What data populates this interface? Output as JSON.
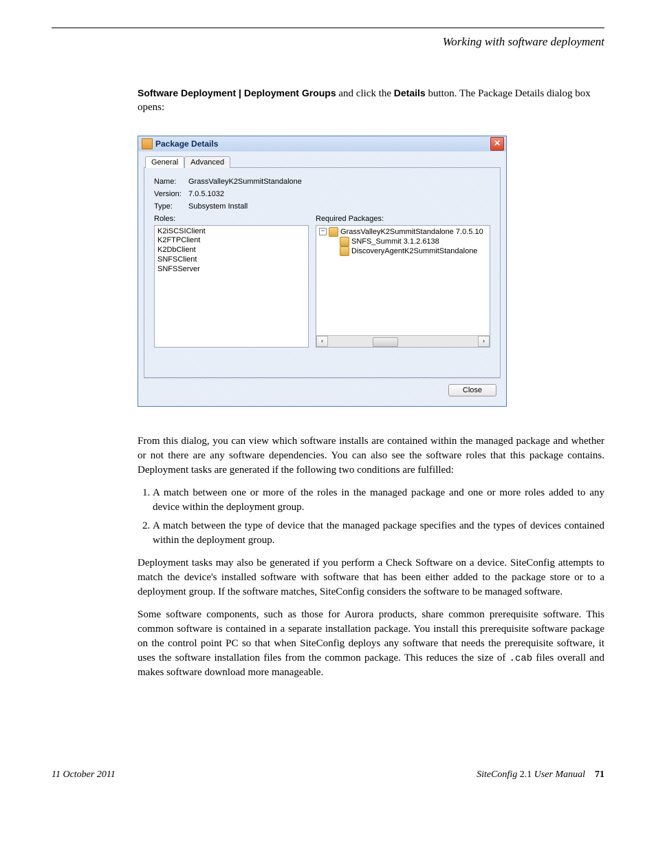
{
  "header": {
    "section_title": "Working with software deployment"
  },
  "intro": {
    "prefix_bold": "Software Deployment | Deployment Groups",
    "mid1": " and click the ",
    "details_bold": "Details",
    "mid2": " button. The Package Details dialog box opens:"
  },
  "dialog": {
    "title": "Package Details",
    "close_glyph": "✕",
    "tabs": {
      "general": "General",
      "advanced": "Advanced"
    },
    "fields": {
      "name_label": "Name:",
      "name_value": "GrassValleyK2SummitStandalone",
      "version_label": "Version:",
      "version_value": "7.0.5.1032",
      "type_label": "Type:",
      "type_value": "Subsystem Install",
      "roles_label": "Roles:",
      "required_label": "Required Packages:"
    },
    "roles": [
      "K2iSCSIClient",
      "K2FTPClient",
      "K2DbClient",
      "SNFSClient",
      "SNFSServer"
    ],
    "packages": {
      "toggle": "−",
      "root": "GrassValleyK2SummitStandalone 7.0.5.10",
      "children": [
        "SNFS_Summit 3.1.2.6138",
        "DiscoveryAgentK2SummitStandalone"
      ],
      "scroll_left": "‹",
      "scroll_right": "›"
    },
    "close_button": "Close"
  },
  "para1": "From this dialog, you can view which software installs are contained within the managed package and whether or not there are any software dependencies. You can also see the software roles that this package contains. Deployment tasks are generated if the following two conditions are fulfilled:",
  "conditions": [
    "A match between one or more of the roles in the managed package and one or more roles added to any device within the deployment group.",
    "A match between the type of device that the managed package specifies and the types of devices contained within the deployment group."
  ],
  "para2": "Deployment tasks may also be generated if you perform a Check Software on a device. SiteConfig attempts to match the device's installed software with software that has been either added to the package store or to a deployment group. If the software matches, SiteConfig considers the software to be managed software.",
  "para3_a": "Some software components, such as those for Aurora products, share common prerequisite software. This common software is contained in a separate installation package. You install this prerequisite software package on the control point PC so that when SiteConfig deploys any software that needs the prerequisite software, it uses the software installation files from the common package. This reduces the size of ",
  "para3_cab": ".cab",
  "para3_b": " files overall and makes software download more manageable.",
  "footer": {
    "date": "11 October 2011",
    "manual_title": "SiteConfig",
    "manual_version": " 2.1 ",
    "manual_suffix": "User Manual",
    "page": "71"
  }
}
